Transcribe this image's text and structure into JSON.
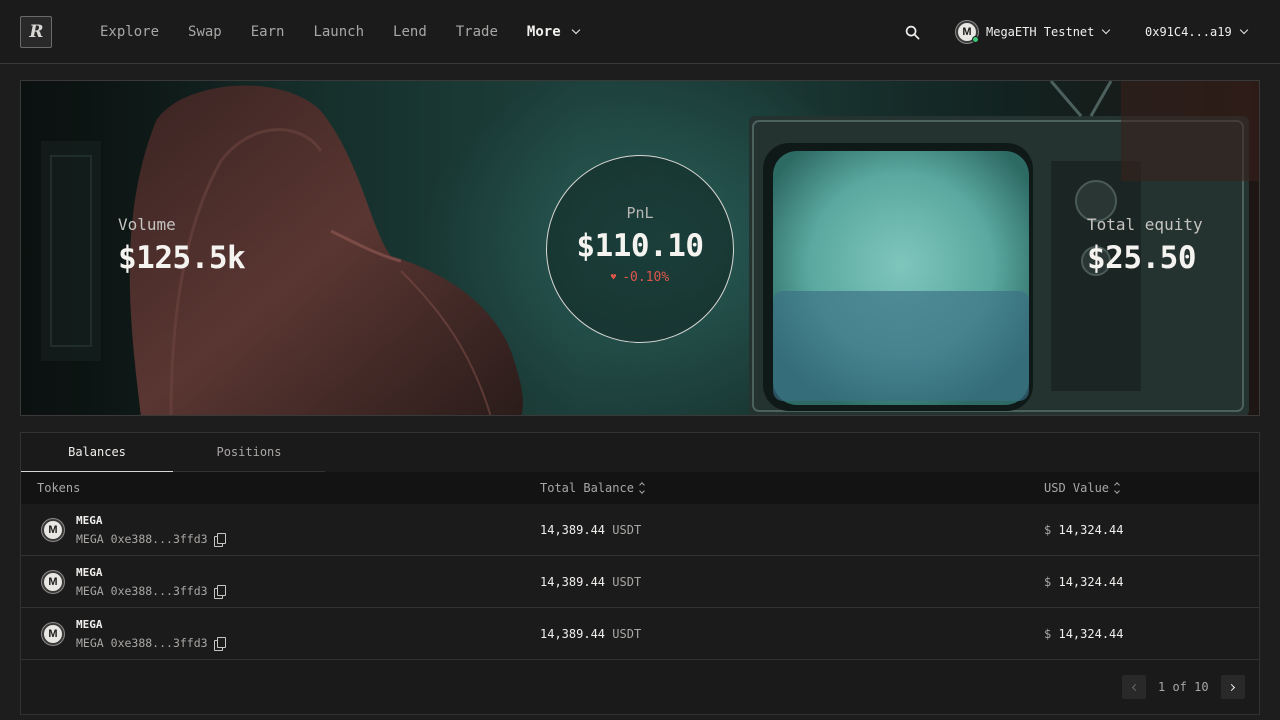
{
  "nav": {
    "logo": "R",
    "links": [
      "Explore",
      "Swap",
      "Earn",
      "Launch",
      "Lend",
      "Trade"
    ],
    "more_label": "More",
    "network_icon_letter": "M",
    "network_label": "MegaETH Testnet",
    "wallet_label": "0x91C4...a19"
  },
  "hero": {
    "volume_label": "Volume",
    "volume_value": "$125.5k",
    "pnl_label": "PnL",
    "pnl_value": "$110.10",
    "pnl_change": "-0.10%",
    "pnl_change_color": "#e0564b",
    "equity_label": "Total equity",
    "equity_value": "$25.50"
  },
  "tabs": [
    "Balances",
    "Positions"
  ],
  "table": {
    "columns": [
      "Tokens",
      "Total Balance",
      "USD Value"
    ],
    "rows": [
      {
        "icon_letter": "M",
        "name": "MEGA",
        "symbol": "MEGA",
        "address": "0xe388...3ffd3",
        "balance": "14,389.44",
        "unit": "USDT",
        "currency": "$",
        "usd": "14,324.44"
      },
      {
        "icon_letter": "M",
        "name": "MEGA",
        "symbol": "MEGA",
        "address": "0xe388...3ffd3",
        "balance": "14,389.44",
        "unit": "USDT",
        "currency": "$",
        "usd": "14,324.44"
      },
      {
        "icon_letter": "M",
        "name": "MEGA",
        "symbol": "MEGA",
        "address": "0xe388...3ffd3",
        "balance": "14,389.44",
        "unit": "USDT",
        "currency": "$",
        "usd": "14,324.44"
      }
    ]
  },
  "pagination": {
    "label": "1 of 10"
  }
}
